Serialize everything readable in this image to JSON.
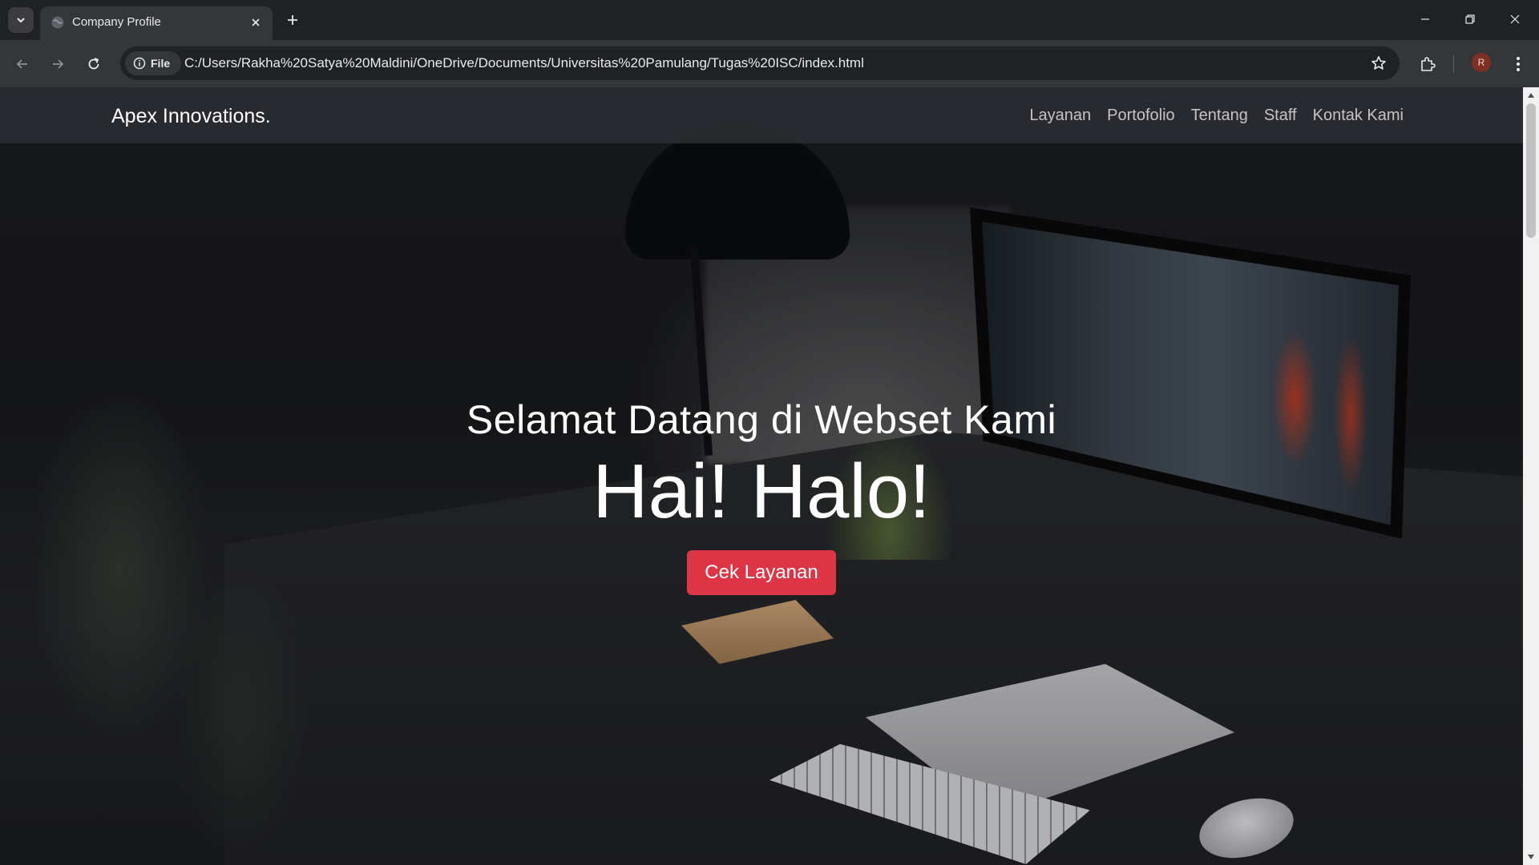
{
  "browser": {
    "tab": {
      "title": "Company Profile"
    },
    "site_chip": "File",
    "url": "C:/Users/Rakha%20Satya%20Maldini/OneDrive/Documents/Universitas%20Pamulang/Tugas%20ISC/index.html",
    "profile_initial": "R"
  },
  "site": {
    "brand": "Apex Innovations.",
    "nav": [
      {
        "label": "Layanan"
      },
      {
        "label": "Portofolio"
      },
      {
        "label": "Tentang"
      },
      {
        "label": "Staff"
      },
      {
        "label": "Kontak Kami"
      }
    ],
    "hero": {
      "lead": "Selamat Datang di Webset Kami",
      "headline": "Hai! Halo!",
      "button": "Cek Layanan"
    }
  },
  "colors": {
    "accent_button": "#dc3545",
    "navbar": "#2b2d31",
    "chrome_dark": "#202124",
    "chrome_toolbar": "#35363a"
  }
}
